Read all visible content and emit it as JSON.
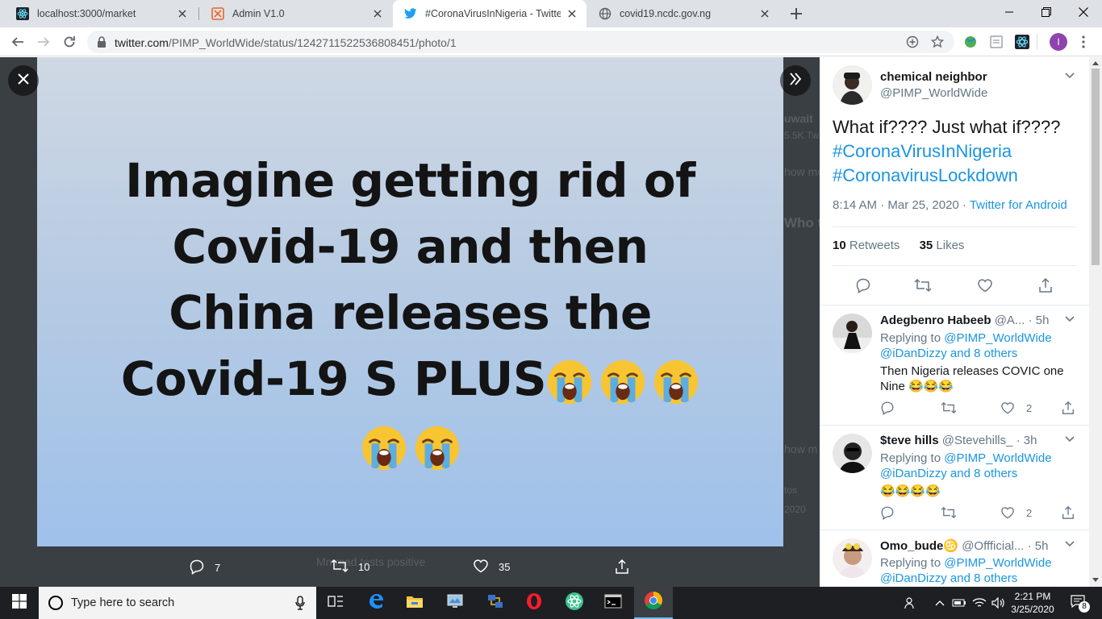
{
  "browser": {
    "tabs": [
      {
        "title": "localhost:3000/market",
        "icon": "react-icon",
        "active": false
      },
      {
        "title": "Admin V1.0",
        "icon": "admin-icon",
        "active": false
      },
      {
        "title": "#CoronaVirusInNigeria - Twitter S",
        "icon": "twitter-icon",
        "active": true
      },
      {
        "title": "covid19.ncdc.gov.ng",
        "icon": "globe-icon",
        "active": false
      }
    ],
    "url": {
      "host": "twitter.com",
      "path": "/PIMP_WorldWide/status/1242711522536808451/photo/1"
    },
    "profile_initial": "I"
  },
  "media": {
    "image_text_lines": [
      "Imagine getting rid of",
      "Covid-19 and then",
      "China releases the",
      "Covid-19 S PLUS"
    ],
    "crying_emoji_count_line4": 3,
    "crying_emoji_count_line5": 2,
    "actions": {
      "replies": "7",
      "retweets": "10",
      "likes": "35"
    },
    "bg_ghost": [
      "uwait",
      "5.5K Tw",
      "how mo",
      "Who t",
      "how m",
      "tos",
      "2020",
      "M",
      "mmad tests positive"
    ]
  },
  "tweet": {
    "author_name": "chemical neighbor",
    "author_handle": "@PIMP_WorldWide",
    "text": "What if???? Just what if????",
    "hashtags": [
      "#CoronaVirusInNigeria",
      "#CoronavirusLockdown"
    ],
    "time": "8:14 AM · Mar 25, 2020 · ",
    "source": "Twitter for Android",
    "retweets_count": "10",
    "retweets_label": " Retweets",
    "likes_count": "35",
    "likes_label": " Likes"
  },
  "replies": [
    {
      "name": "Adegbenro Habeeb",
      "handle_time": " @A... · 5h",
      "replying_prefix": "Replying to ",
      "replying_to": "@PIMP_WorldWide",
      "replying_rest": "@iDanDizzy and 8 others",
      "text": "Then Nigeria releases COVIC one Nine 😂😂😂",
      "likes": "2"
    },
    {
      "name": "$teve hills",
      "handle_time": " @Stevehills_ · 3h",
      "replying_prefix": "Replying to ",
      "replying_to": "@PIMP_WorldWide",
      "replying_rest": "@iDanDizzy and 8 others",
      "text": "😂😂😂😂",
      "likes": "2"
    },
    {
      "name": "Omo_bude♋",
      "handle_time": " @Offficial... · 5h",
      "replying_prefix": "Replying to ",
      "replying_to": "@PIMP_WorldWide",
      "replying_rest": "@iDanDizzy and 8 others",
      "text": "",
      "likes": ""
    }
  ],
  "taskbar": {
    "search_placeholder": "Type here to search",
    "time": "2:21 PM",
    "date": "3/25/2020",
    "notifications": "8"
  },
  "colors": {
    "twitter_blue": "#1b95e0",
    "text_primary": "#14171a",
    "text_secondary": "#657786",
    "media_backdrop": "#3a3f44"
  }
}
